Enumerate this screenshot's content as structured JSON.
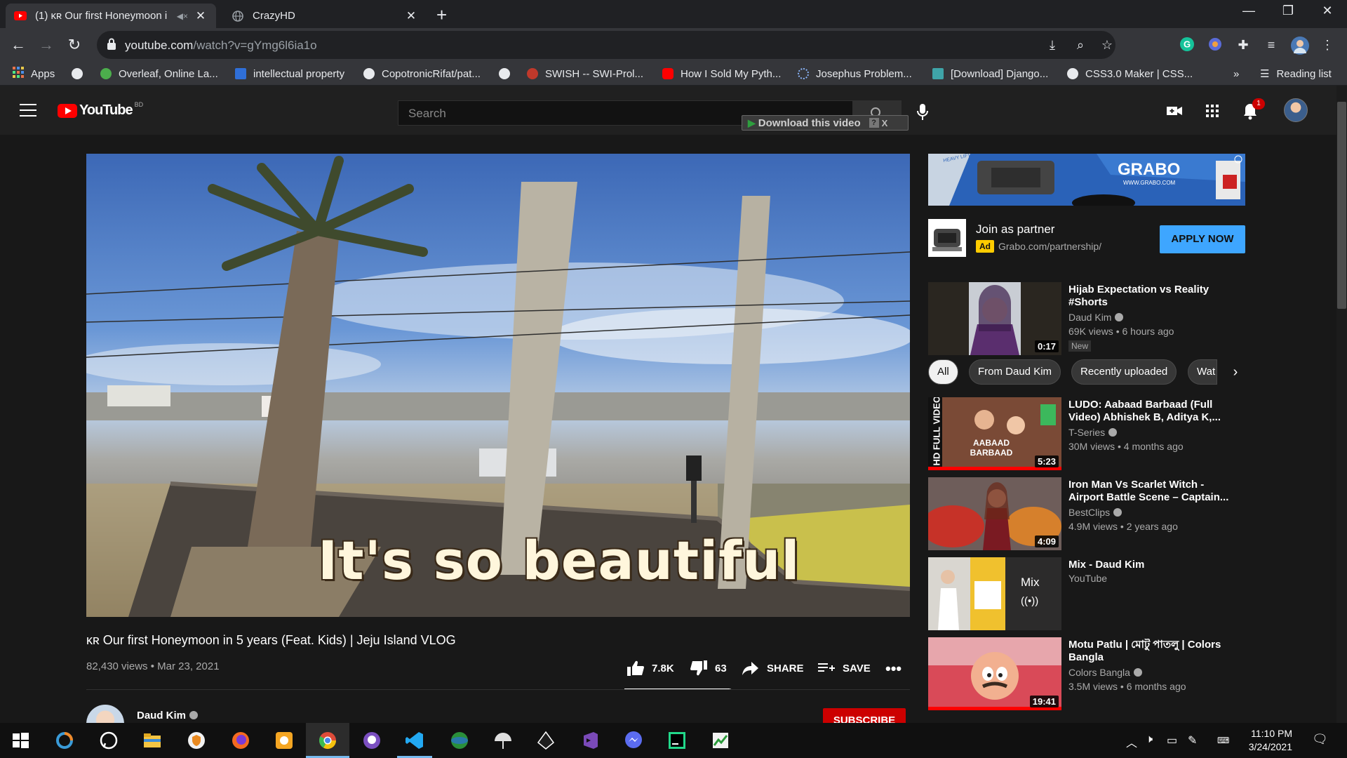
{
  "browser": {
    "tabs": [
      {
        "title": "(1) ᴋʀ Our first Honeymoon i",
        "active": true
      },
      {
        "title": "CrazyHD",
        "active": false
      }
    ],
    "url_domain": "youtube.com",
    "url_path": "/watch?v=gYmg6l6ia1o",
    "bookmarks": [
      "Apps",
      "Overleaf, Online La...",
      "intellectual property",
      "CopotronicRifat/pat...",
      "SWISH -- SWI-Prol...",
      "How I Sold My Pyth...",
      "Josephus Problem...",
      "[Download] Django...",
      "CSS3.0 Maker | CSS..."
    ],
    "bookmarks_more": "»",
    "reading_list": "Reading list"
  },
  "youtube": {
    "logo_text": "YouTube",
    "country_code": "BD",
    "search_placeholder": "Search",
    "download_label": "Download this video",
    "download_help": "?",
    "download_close": "X",
    "notification_count": "1",
    "video": {
      "caption": "It's so beautiful",
      "title": "ᴋʀ Our first Honeymoon in 5 years (Feat. Kids) | Jeju Island VLOG",
      "views": "82,430 views",
      "date": "Mar 23, 2021",
      "likes": "7.8K",
      "dislikes": "63",
      "share": "SHARE",
      "save": "SAVE",
      "like_ratio": 0.99
    },
    "channel": {
      "name": "Daud Kim",
      "subscribe": "SUBSCRIBE"
    },
    "ad": {
      "banner_brand": "GRABO",
      "banner_site": "WWW.GRABO.COM",
      "banner_tagline": "HEAVY LIFTING MADE EASY",
      "title": "Join as partner",
      "badge": "Ad",
      "url": "Grabo.com/partnership/",
      "cta": "APPLY NOW"
    },
    "chips": [
      "All",
      "From Daud Kim",
      "Recently uploaded",
      "Wat"
    ],
    "recommendations": [
      {
        "title": "Hijab Expectation vs Reality #Shorts",
        "channel": "Daud Kim",
        "meta": "69K views • 6 hours ago",
        "duration": "0:17",
        "badge": "New"
      },
      {
        "title": "LUDO: Aabaad Barbaad (Full Video) Abhishek B, Aditya K,...",
        "channel": "T-Series",
        "meta": "30M views • 4 months ago",
        "duration": "5:23",
        "thumb_text": "HD FULL VIDEO",
        "thumb_caption": "AABAAD BARBAAD"
      },
      {
        "title": "Iron Man Vs Scarlet Witch - Airport Battle Scene – Captain...",
        "channel": "BestClips",
        "meta": "4.9M views • 2 years ago",
        "duration": "4:09"
      },
      {
        "title": "Mix - Daud Kim",
        "channel": "YouTube",
        "meta": "",
        "mix_label": "Mix"
      },
      {
        "title": "Motu Patlu | মোটু পাতলু | Colors Bangla",
        "channel": "Colors Bangla",
        "meta": "3.5M views • 6 months ago",
        "duration": "19:41"
      }
    ]
  },
  "taskbar": {
    "time": "11:10 PM",
    "date": "3/24/2021"
  },
  "colors": {
    "yt_red": "#ff0000",
    "subscribe_red": "#cc0000",
    "apply_blue": "#3ea6ff",
    "ad_yellow": "#ffcc00"
  }
}
